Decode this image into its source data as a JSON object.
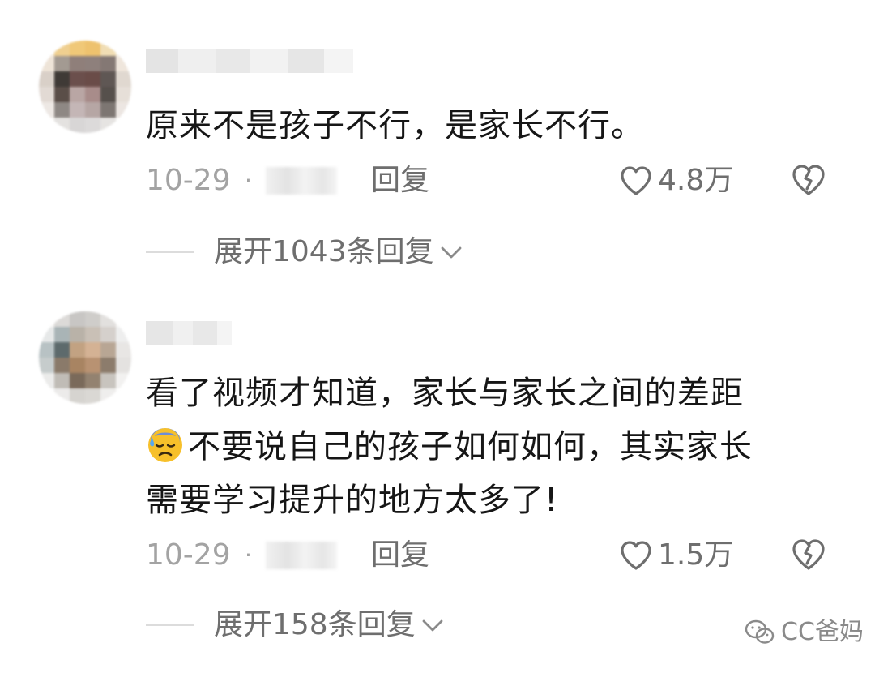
{
  "comments": [
    {
      "text": "原来不是孩子不行，是家长不行。",
      "date": "10-29",
      "separator": "·",
      "reply_label": "回复",
      "like_count": "4.8万",
      "expand_label": "展开1043条回复"
    },
    {
      "text_lines": [
        "看了视频才知道，家长与家长之间的差距",
        "不要说自己的孩子如何如何，其实家长",
        "需要学习提升的地方太多了!"
      ],
      "date": "10-29",
      "separator": "·",
      "reply_label": "回复",
      "like_count": "1.5万",
      "expand_label": "展开158条回复"
    }
  ],
  "watermark": {
    "text": "CC爸妈"
  },
  "icons": {
    "like": "heart-outline-icon",
    "dislike": "broken-heart-icon",
    "expand": "chevron-down-icon",
    "emoji": "downcast-sweat-face-emoji",
    "watermark": "wechat-search-icon"
  },
  "colors": {
    "text_primary": "#161616",
    "text_secondary": "#a3a3a3",
    "text_action": "#6e6e6e",
    "divider": "#dcdcdc"
  }
}
